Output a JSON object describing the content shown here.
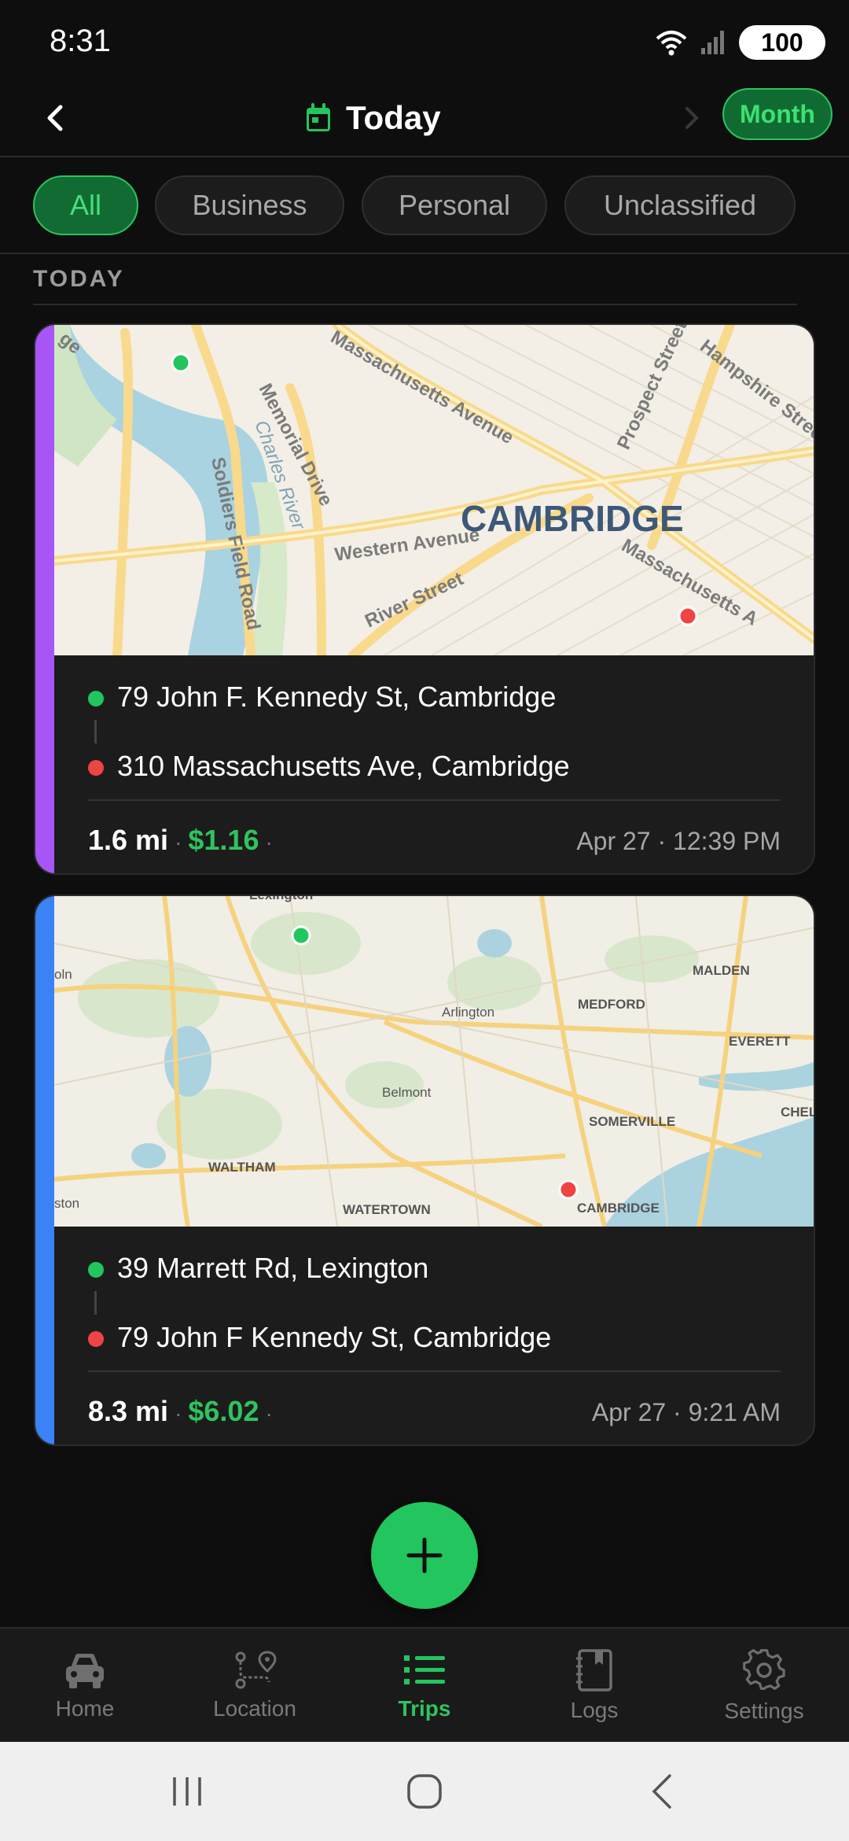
{
  "status_bar": {
    "time": "8:31",
    "battery": "100",
    "icons": [
      "wifi-icon",
      "signal-icon"
    ]
  },
  "header": {
    "title": "Today",
    "icon": "calendar-icon",
    "month_button": "Month",
    "accent_color": "#22c55e"
  },
  "filters": [
    {
      "label": "All",
      "active": true
    },
    {
      "label": "Business",
      "active": false
    },
    {
      "label": "Personal",
      "active": false
    },
    {
      "label": "Unclassified",
      "active": false
    }
  ],
  "section": {
    "label": "TODAY"
  },
  "trips": [
    {
      "stripe_color": "#a855f7",
      "start": "79 John F. Kennedy St, Cambridge",
      "end": "310 Massachusetts Ave, Cambridge",
      "distance": "1.6 mi",
      "cost": "$1.16",
      "datetime": "Apr 27 · 12:39 PM",
      "map_labels": {
        "city": "CAMBRIDGE",
        "streets": [
          "Massachusetts Avenue",
          "Memorial Drive",
          "Charles River",
          "Soldiers Field Road",
          "Western Avenue",
          "River Street",
          "Prospect Street",
          "Hampshire Street",
          "Massachusetts A"
        ]
      }
    },
    {
      "stripe_color": "#3b82f6",
      "start": "39 Marrett Rd, Lexington",
      "end": "79 John F Kennedy St, Cambridge",
      "distance": "8.3 mi",
      "cost": "$6.02",
      "datetime": "Apr 27 · 9:21 AM",
      "map_labels": {
        "places": [
          "Lexington",
          "MALDEN",
          "MEDFORD",
          "Arlington",
          "EVERETT",
          "Belmont",
          "CHEL",
          "SOMERVILLE",
          "WALTHAM",
          "WATERTOWN",
          "CAMBRIDGE",
          "oln",
          "ston"
        ]
      }
    }
  ],
  "fab": {
    "icon": "plus-icon"
  },
  "bottom_nav": [
    {
      "label": "Home",
      "icon": "car-icon",
      "active": false
    },
    {
      "label": "Location",
      "icon": "route-icon",
      "active": false
    },
    {
      "label": "Trips",
      "icon": "list-icon",
      "active": true
    },
    {
      "label": "Logs",
      "icon": "logbook-icon",
      "active": false
    },
    {
      "label": "Settings",
      "icon": "gear-icon",
      "active": false
    }
  ]
}
